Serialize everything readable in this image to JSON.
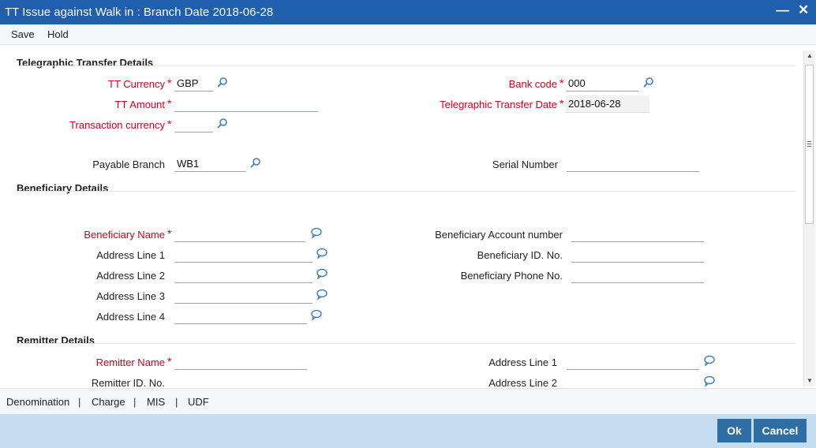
{
  "window": {
    "title": "TT Issue against Walk in : Branch Date 2018-06-28"
  },
  "menu": {
    "save": "Save",
    "hold": "Hold"
  },
  "sections": {
    "tt_details": "Telegraphic Transfer Details",
    "beneficiary": "Beneficiary Details",
    "remitter": "Remitter Details"
  },
  "tt": {
    "currency_label": "TT Currency",
    "currency_value": "GBP",
    "amount_label": "TT Amount",
    "amount_value": "",
    "txn_currency_label": "Transaction currency",
    "txn_currency_value": "",
    "payable_branch_label": "Payable Branch",
    "payable_branch_value": "WB1",
    "bank_code_label": "Bank code",
    "bank_code_value": "000",
    "tt_date_label": "Telegraphic Transfer Date",
    "tt_date_value": "2018-06-28",
    "serial_label": "Serial Number",
    "serial_value": ""
  },
  "beneficiary": {
    "name_label": "Beneficiary Name",
    "addr1_label": "Address Line 1",
    "addr2_label": "Address Line 2",
    "addr3_label": "Address Line 3",
    "addr4_label": "Address Line 4",
    "account_label": "Beneficiary Account number",
    "id_label": "Beneficiary ID. No.",
    "phone_label": "Beneficiary Phone No."
  },
  "remitter": {
    "name_label": "Remitter Name",
    "id_label": "Remitter ID. No.",
    "addr1_label": "Address Line 1",
    "addr2_label": "Address Line 2"
  },
  "required_marker": "*",
  "tabs": {
    "denomination": "Denomination",
    "charge": "Charge",
    "mis": "MIS",
    "udf": "UDF",
    "separator": "|"
  },
  "buttons": {
    "ok": "Ok",
    "cancel": "Cancel"
  },
  "icons": {
    "lookup": "search-icon",
    "narrative": "speech-bubble-icon",
    "minimize": "minimize-icon",
    "close": "close-icon"
  },
  "colors": {
    "titlebar": "#1f5fad",
    "required": "#d0021b",
    "button": "#2e6ea5",
    "footer": "#c5ddf0",
    "icon": "#3a7fc1"
  }
}
